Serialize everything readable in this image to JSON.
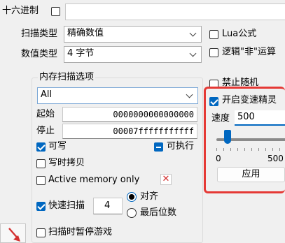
{
  "top": {
    "hex_label": "十六进制",
    "hex_checked": false,
    "value_input": ""
  },
  "scan_type": {
    "label": "扫描类型",
    "selected": "精确数值"
  },
  "value_type": {
    "label": "数值类型",
    "selected": "4 字节"
  },
  "right_options": {
    "lua_formula": "Lua公式",
    "logical_not": "逻辑\"非\"运算",
    "disable_random": "禁止随机"
  },
  "memory_group": {
    "title": "内存扫描选项",
    "region_selected": "All",
    "start_label": "起始",
    "start_value": "0000000000000000",
    "stop_label": "停止",
    "stop_value": "00007fffffffffff",
    "writable_label": "可写",
    "executable_label": "可执行",
    "cow_label": "写时拷贝",
    "active_memory_label": "Active memory only",
    "fast_scan_label": "快速扫描",
    "fast_scan_value": "4",
    "align_label": "对齐",
    "last_digits_label": "最后位数",
    "pause_game_label": "扫描时暂停游戏"
  },
  "speedhack": {
    "enable_label": "开启变速精灵",
    "speed_label": "速度",
    "speed_value": "500",
    "slider_min": "0",
    "slider_max": "500",
    "slider_level": 0.16,
    "apply_label": "应用"
  },
  "colors": {
    "accent": "#0067c0",
    "highlight_border": "#e53935",
    "close_red": "#d32f2f"
  }
}
